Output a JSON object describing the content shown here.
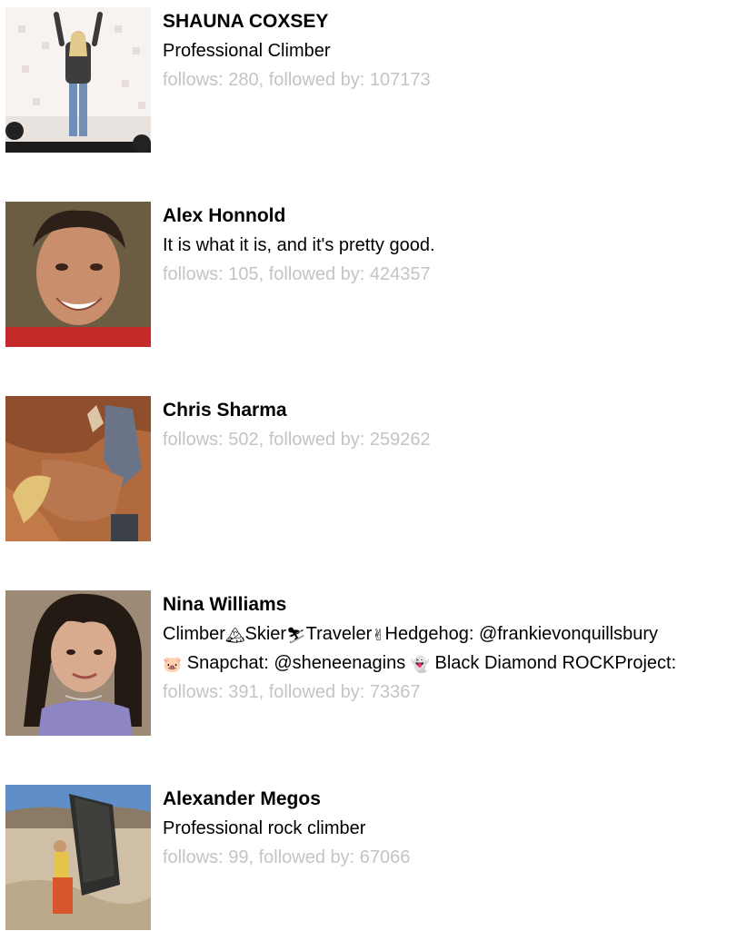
{
  "profiles": [
    {
      "name": "SHAUNA COXSEY",
      "bio": "Professional Climber",
      "follows": "280",
      "followed_by": "107173",
      "stats": "follows: 280, followed by: 107173"
    },
    {
      "name": "Alex Honnold",
      "bio": "It is what it is, and it's pretty good.",
      "follows": "105",
      "followed_by": "424357",
      "stats": "follows: 105, followed by: 424357"
    },
    {
      "name": "Chris Sharma",
      "bio": "",
      "follows": "502",
      "followed_by": "259262",
      "stats": "follows: 502, followed by: 259262"
    },
    {
      "name": "Nina Williams",
      "bio_parts": {
        "p1": "Climber",
        "e1": "🏔",
        "p2": "Skier",
        "e2": "⛷",
        "p3": "Traveler",
        "e3": "✌",
        "p4": "Hedgehog: @frankievonquillsbury",
        "e4": "🐷",
        "p5": " Snapchat: @sheneenagins ",
        "e5": "👻",
        "p6": " Black Diamond ROCKProject:"
      },
      "follows": "391",
      "followed_by": "73367",
      "stats": "follows: 391, followed by: 73367"
    },
    {
      "name": "Alexander Megos",
      "bio": "Professional rock climber",
      "follows": "99",
      "followed_by": "67066",
      "stats": "follows: 99, followed by: 67066"
    }
  ],
  "colors": {
    "stats_text": "#c4c4c4",
    "name_text": "#000000",
    "bio_text": "#000000"
  }
}
